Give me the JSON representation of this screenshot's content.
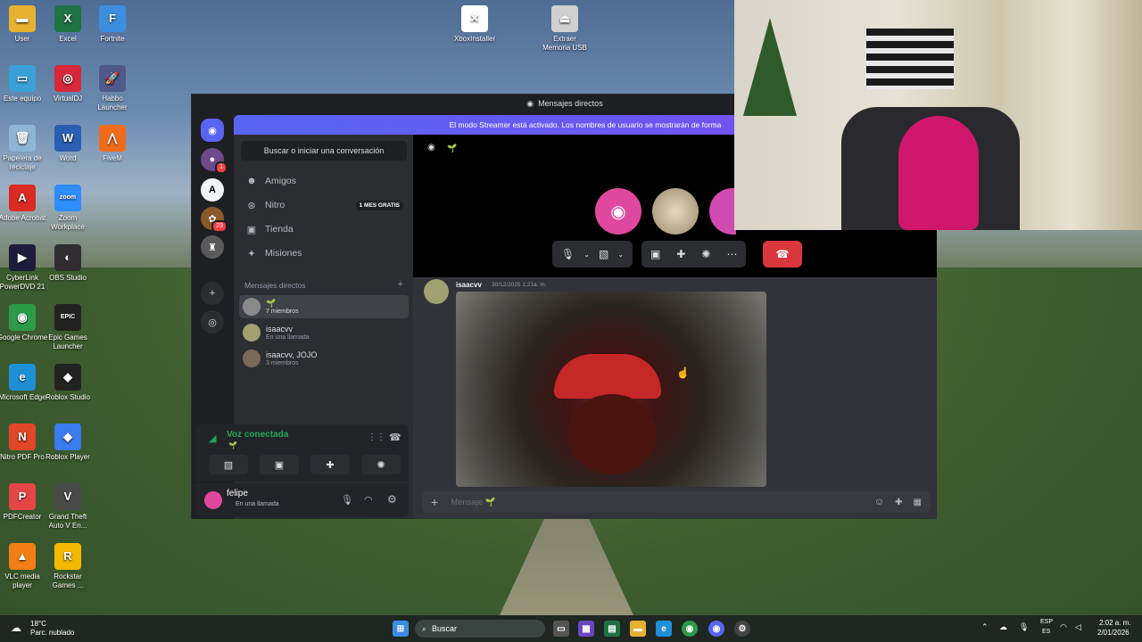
{
  "desktop": {
    "icons_col1": [
      {
        "label": "User",
        "icon": "folder-icon",
        "color": "#e7b232",
        "glyph": "▬"
      },
      {
        "label": "Este equipo",
        "icon": "monitor-icon",
        "color": "#3aa0d8",
        "glyph": "▭"
      },
      {
        "label": "Papelera de reciclaje",
        "icon": "recycle-bin-icon",
        "color": "#8fb5d4",
        "glyph": "🗑"
      },
      {
        "label": "Adobe Acrobat",
        "icon": "acrobat-icon",
        "color": "#d92b22",
        "glyph": "A"
      },
      {
        "label": "CyberLink PowerDVD 21",
        "icon": "powerdvd-icon",
        "color": "#1d1d3a",
        "glyph": "▶"
      },
      {
        "label": "Google Chrome",
        "icon": "chrome-icon",
        "color": "#2b9a49",
        "glyph": "◉"
      },
      {
        "label": "Microsoft Edge",
        "icon": "edge-icon",
        "color": "#1f8fd6",
        "glyph": "e"
      },
      {
        "label": "Nitro PDF Pro",
        "icon": "nitro-icon",
        "color": "#e0462a",
        "glyph": "N"
      },
      {
        "label": "PDFCreator",
        "icon": "pdfcreator-icon",
        "color": "#e64545",
        "glyph": "P"
      },
      {
        "label": "VLC media player",
        "icon": "vlc-icon",
        "color": "#f07e15",
        "glyph": "▲"
      }
    ],
    "icons_col2": [
      {
        "label": "Excel",
        "icon": "excel-icon",
        "color": "#1f7244",
        "glyph": "X"
      },
      {
        "label": "VirtualDJ",
        "icon": "virtualdj-icon",
        "color": "#d62839",
        "glyph": "◎"
      },
      {
        "label": "Word",
        "icon": "word-icon",
        "color": "#2b5fb4",
        "glyph": "W"
      },
      {
        "label": "Zoom Workplace",
        "icon": "zoom-icon",
        "color": "#2d8cff",
        "glyph": "zoom"
      },
      {
        "label": "OBS Studio",
        "icon": "obs-icon",
        "color": "#302e31",
        "glyph": "◐"
      },
      {
        "label": "Epic Games Launcher",
        "icon": "epic-icon",
        "color": "#222222",
        "glyph": "EPIC"
      },
      {
        "label": "Roblox Studio",
        "icon": "roblox-studio-icon",
        "color": "#222222",
        "glyph": "◆"
      },
      {
        "label": "Roblox Player",
        "icon": "roblox-player-icon",
        "color": "#3a7bf0",
        "glyph": "◆"
      },
      {
        "label": "Grand Theft Auto V En...",
        "icon": "gta-icon",
        "color": "#4a4a4a",
        "glyph": "V"
      },
      {
        "label": "Rockstar Games ...",
        "icon": "rockstar-icon",
        "color": "#f5b800",
        "glyph": "R"
      }
    ],
    "icons_col3": [
      {
        "label": "Fortnite",
        "icon": "fortnite-icon",
        "color": "#3e8ee0",
        "glyph": "F"
      },
      {
        "label": "Habbo Launcher",
        "icon": "habbo-icon",
        "color": "#4f5a8a",
        "glyph": "🚀"
      },
      {
        "label": "FiveM",
        "icon": "fivem-icon",
        "color": "#f26b1d",
        "glyph": "⋀"
      }
    ],
    "icons_top": [
      {
        "label": "XboxInstaller",
        "icon": "xbox-icon",
        "color": "#ffffff",
        "glyph": "✕"
      },
      {
        "label": "Extraer Memoria USB",
        "icon": "usb-icon",
        "color": "#d0d0d0",
        "glyph": "⏏"
      }
    ]
  },
  "discord": {
    "window_title": "Mensajes directos",
    "streamer_banner": "El modo Streamer está activado. Los nombres de usuario se mostrarán de forma",
    "guild_badge": "23",
    "guild_badge_small": "1",
    "search_placeholder": "Buscar o iniciar una conversación",
    "nav": [
      {
        "label": "Amigos",
        "icon": "friends-icon",
        "glyph": "☻"
      },
      {
        "label": "Nitro",
        "icon": "nitro-icon",
        "glyph": "⊛"
      },
      {
        "label": "Tienda",
        "icon": "shop-icon",
        "glyph": "▣"
      },
      {
        "label": "Misiones",
        "icon": "quests-icon",
        "glyph": "✦"
      }
    ],
    "nitro_promo": "1 MES GRATIS",
    "dm_header": "Mensajes directos",
    "dm_add": "+",
    "dms": [
      {
        "name": "🌱",
        "sub": "7 miembros",
        "color": "#6b8f3c"
      },
      {
        "name": "isaacvv",
        "sub": "En una llamada",
        "color": "#a0a070"
      },
      {
        "name": "isaacvv, JOJO",
        "sub": "3 miembros",
        "color": "#7a6a5a"
      }
    ],
    "voice": {
      "status": "Voz conectada",
      "channel": "🌱"
    },
    "user": {
      "name": "felipe",
      "status": "En una llamada"
    },
    "call_channel": "🌱",
    "message": {
      "author": "isaacvv",
      "timestamp": "30/12/2025 1:21a. m."
    },
    "input_placeholder": "Mensaje 🌱",
    "accent": "#5865f2",
    "danger": "#da373c",
    "online": "#23a55a"
  },
  "taskbar": {
    "weather_temp": "18°C",
    "weather_desc": "Parc. nublado",
    "search_label": "Buscar",
    "lang_top": "ESP",
    "lang_bottom": "ES",
    "time": "2:02 a. m.",
    "date": "2/01/2026"
  }
}
